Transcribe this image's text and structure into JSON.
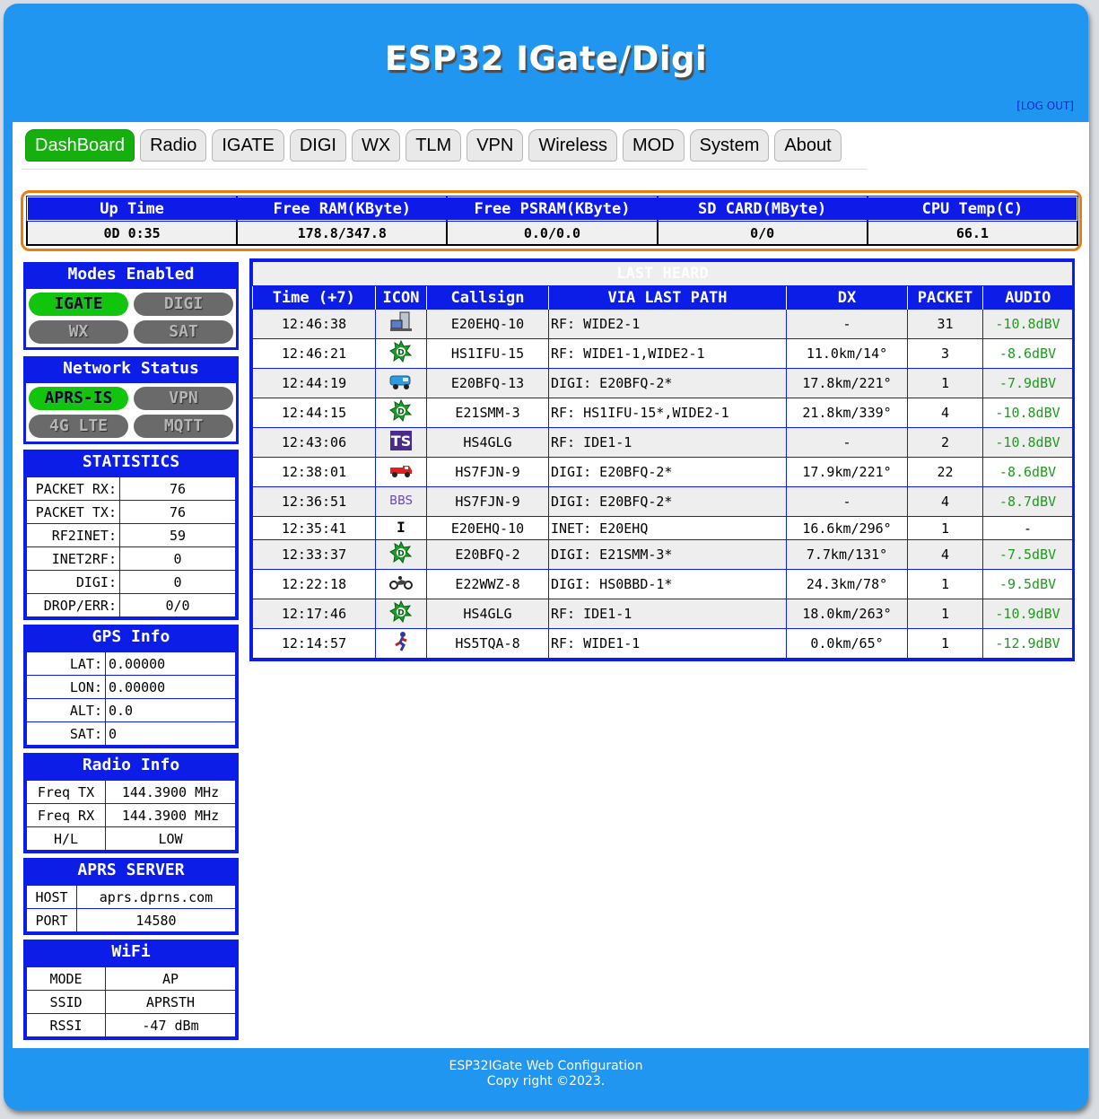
{
  "header": {
    "title": "ESP32 IGate/Digi",
    "logout": "[LOG OUT]"
  },
  "tabs": [
    "DashBoard",
    "Radio",
    "IGATE",
    "DIGI",
    "WX",
    "TLM",
    "VPN",
    "Wireless",
    "MOD",
    "System",
    "About"
  ],
  "system_stats": {
    "headers": [
      "Up Time",
      "Free RAM(KByte)",
      "Free PSRAM(KByte)",
      "SD CARD(MByte)",
      "CPU Temp(C)"
    ],
    "values": [
      "0D 0:35",
      "178.8/347.8",
      "0.0/0.0",
      "0/0",
      "66.1"
    ]
  },
  "modes": {
    "title": "Modes Enabled",
    "items": [
      {
        "label": "IGATE",
        "enabled": true
      },
      {
        "label": "DIGI",
        "enabled": false
      },
      {
        "label": "WX",
        "enabled": false
      },
      {
        "label": "SAT",
        "enabled": false
      }
    ]
  },
  "network": {
    "title": "Network Status",
    "items": [
      {
        "label": "APRS-IS",
        "enabled": true
      },
      {
        "label": "VPN",
        "enabled": false
      },
      {
        "label": "4G LTE",
        "enabled": false
      },
      {
        "label": "MQTT",
        "enabled": false
      }
    ]
  },
  "statistics": {
    "title": "STATISTICS",
    "rows": [
      {
        "k": "PACKET RX:",
        "v": "76"
      },
      {
        "k": "PACKET TX:",
        "v": "76"
      },
      {
        "k": "RF2INET:",
        "v": "59"
      },
      {
        "k": "INET2RF:",
        "v": "0"
      },
      {
        "k": "DIGI:",
        "v": "0"
      },
      {
        "k": "DROP/ERR:",
        "v": "0/0"
      }
    ]
  },
  "gps": {
    "title": "GPS Info",
    "rows": [
      {
        "k": "LAT:",
        "v": "0.00000"
      },
      {
        "k": "LON:",
        "v": "0.00000"
      },
      {
        "k": "ALT:",
        "v": "0.0"
      },
      {
        "k": "SAT:",
        "v": "0"
      }
    ]
  },
  "radio": {
    "title": "Radio Info",
    "rows": [
      {
        "k": "Freq TX",
        "v": "144.3900 MHz"
      },
      {
        "k": "Freq RX",
        "v": "144.3900 MHz"
      },
      {
        "k": "H/L",
        "v": "LOW"
      }
    ]
  },
  "aprs_server": {
    "title": "APRS SERVER",
    "rows": [
      {
        "k": "HOST",
        "v": "aprs.dprns.com"
      },
      {
        "k": "PORT",
        "v": "14580"
      }
    ]
  },
  "wifi": {
    "title": "WiFi",
    "rows": [
      {
        "k": "MODE",
        "v": "AP"
      },
      {
        "k": "SSID",
        "v": "APRSTH"
      },
      {
        "k": "RSSI",
        "v": "-47 dBm"
      }
    ]
  },
  "last_heard": {
    "title": "LAST HEARD",
    "columns": [
      "Time (+7)",
      "ICON",
      "Callsign",
      "VIA LAST PATH",
      "DX",
      "PACKET",
      "AUDIO"
    ],
    "rows": [
      {
        "time": "12:46:38",
        "icon": "server-icon",
        "call": "E20EHQ-10",
        "via": "RF: WIDE2-1",
        "dx": "-",
        "packet": "31",
        "audio": "-10.8dBV"
      },
      {
        "time": "12:46:21",
        "icon": "digi-star-icon",
        "call": "HS1IFU-15",
        "via": "RF: WIDE1-1,WIDE2-1",
        "dx": "11.0km/14°",
        "packet": "3",
        "audio": "-8.6dBV"
      },
      {
        "time": "12:44:19",
        "icon": "van-icon",
        "call": "E20BFQ-13",
        "via": "DIGI: E20BFQ-2*",
        "dx": "17.8km/221°",
        "packet": "1",
        "audio": "-7.9dBV"
      },
      {
        "time": "12:44:15",
        "icon": "digi-star-icon",
        "call": "E21SMM-3",
        "via": "RF: HS1IFU-15*,WIDE2-1",
        "dx": "21.8km/339°",
        "packet": "4",
        "audio": "-10.8dBV"
      },
      {
        "time": "12:43:06",
        "icon": "ts-icon",
        "call": "HS4GLG",
        "via": "RF:  IDE1-1",
        "dx": "-",
        "packet": "2",
        "audio": "-10.8dBV"
      },
      {
        "time": "12:38:01",
        "icon": "truck-icon",
        "call": "HS7FJN-9",
        "via": "DIGI: E20BFQ-2*",
        "dx": "17.9km/221°",
        "packet": "22",
        "audio": "-8.6dBV"
      },
      {
        "time": "12:36:51",
        "icon": "bbs-icon",
        "call": "HS7FJN-9",
        "via": "DIGI: E20BFQ-2*",
        "dx": "-",
        "packet": "4",
        "audio": "-8.7dBV"
      },
      {
        "time": "12:35:41",
        "icon": "i-icon",
        "call": "E20EHQ-10",
        "via": "INET: E20EHQ",
        "dx": "16.6km/296°",
        "packet": "1",
        "audio": "-"
      },
      {
        "time": "12:33:37",
        "icon": "digi-star-icon",
        "call": "E20BFQ-2",
        "via": "DIGI: E21SMM-3*",
        "dx": "7.7km/131°",
        "packet": "4",
        "audio": "-7.5dBV"
      },
      {
        "time": "12:22:18",
        "icon": "motorcycle-icon",
        "call": "E22WWZ-8",
        "via": "DIGI: HS0BBD-1*",
        "dx": "24.3km/78°",
        "packet": "1",
        "audio": "-9.5dBV"
      },
      {
        "time": "12:17:46",
        "icon": "digi-star-icon",
        "call": "HS4GLG",
        "via": "RF:  IDE1-1",
        "dx": "18.0km/263°",
        "packet": "1",
        "audio": "-10.9dBV"
      },
      {
        "time": "12:14:57",
        "icon": "runner-icon",
        "call": "HS5TQA-8",
        "via": "RF: WIDE1-1",
        "dx": "0.0km/65°",
        "packet": "1",
        "audio": "-12.9dBV"
      }
    ]
  },
  "footer": {
    "line1": "ESP32IGate Web Configuration",
    "line2": "Copy right ©2023."
  }
}
